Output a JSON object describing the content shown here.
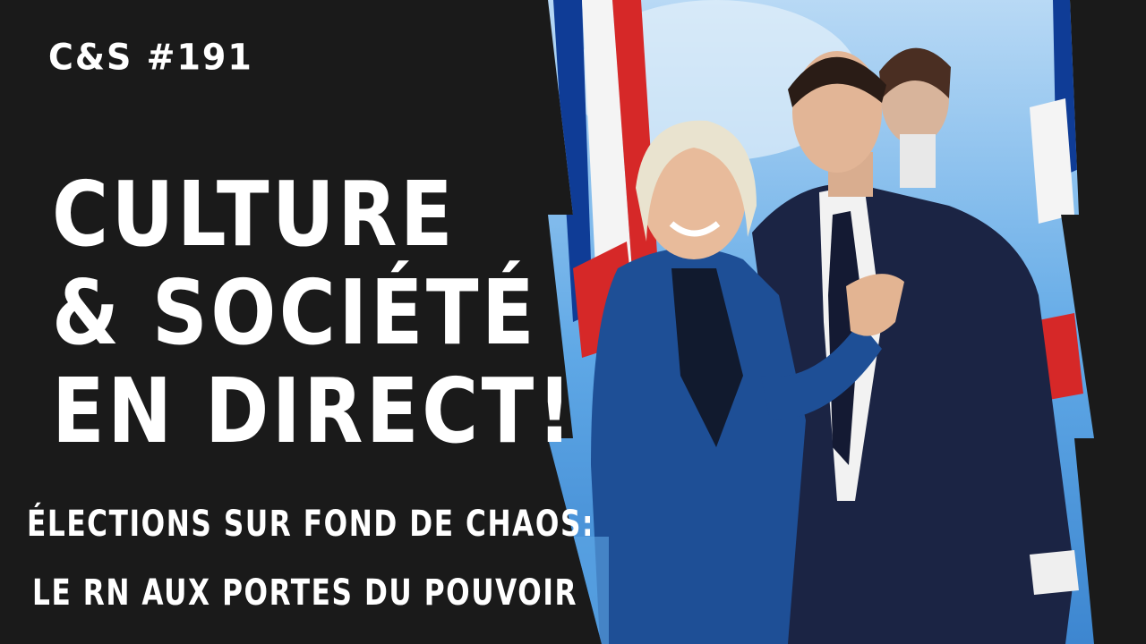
{
  "episode_label": "C&S #191",
  "title_lines": [
    "CULTURE",
    "& SOCIÉTÉ",
    "EN DIRECT!"
  ],
  "subtitle_lines": [
    "ÉLECTIONS SUR FOND DE CHAOS:",
    "LE RN AUX PORTES DU POUVOIR"
  ],
  "colors": {
    "background": "#1a1a1a",
    "text": "#ffffff",
    "stage_sky": "#5fa8e6",
    "flag_blue": "#0f3c96",
    "flag_red": "#d62828",
    "jacket_blue": "#1e4f96",
    "suit_navy": "#1b2444"
  }
}
